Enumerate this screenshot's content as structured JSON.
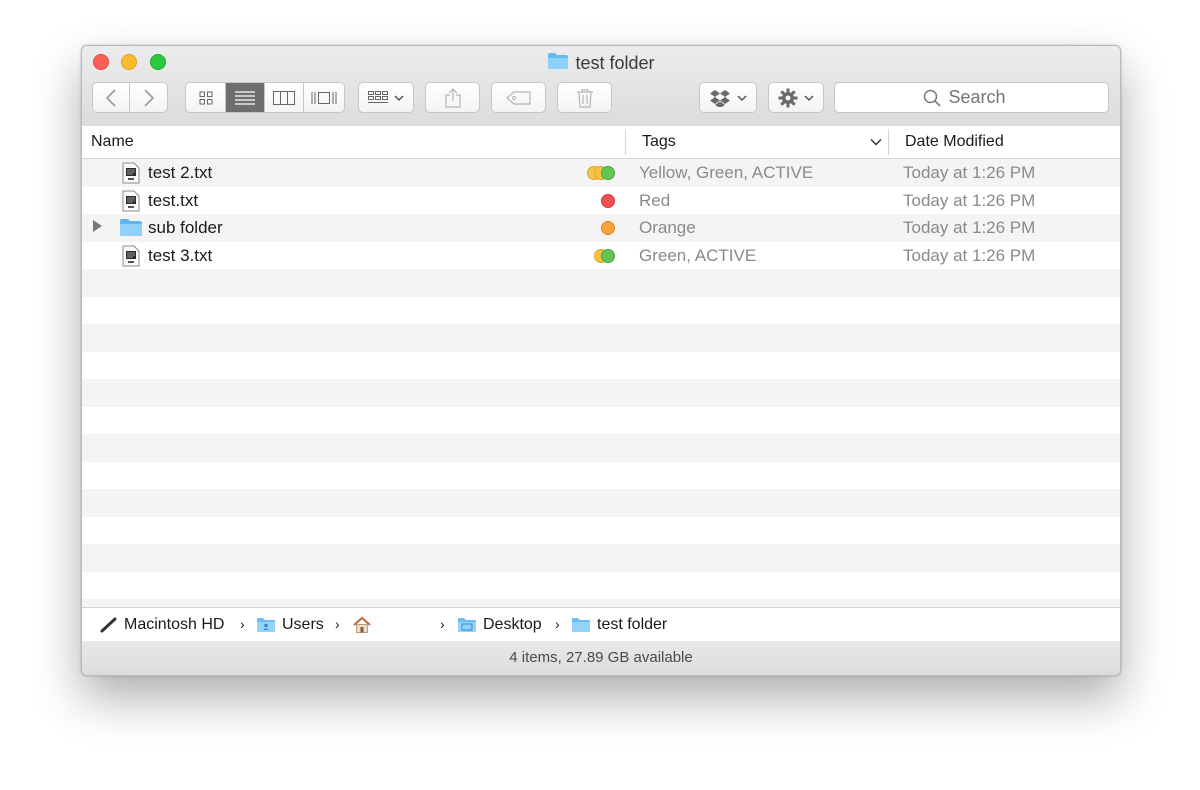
{
  "window": {
    "title": "test folder"
  },
  "toolbar": {
    "search_placeholder": "Search"
  },
  "columns": {
    "name": "Name",
    "tags": "Tags",
    "date": "Date Modified"
  },
  "files": [
    {
      "name": "test 2.txt",
      "kind": "text-file-icon",
      "tags": "Yellow, Green, ACTIVE",
      "date": "Today at 1:26 PM",
      "tag_colors": [
        "#f6c244",
        "#f6c244",
        "#62c554"
      ]
    },
    {
      "name": "test.txt",
      "kind": "text-file-icon",
      "tags": "Red",
      "date": "Today at 1:26 PM",
      "tag_colors": [
        "#f05050"
      ]
    },
    {
      "name": "sub folder",
      "kind": "folder-icon",
      "tags": "Orange",
      "date": "Today at 1:26 PM",
      "tag_colors": [
        "#f7a23b"
      ]
    },
    {
      "name": "test 3.txt",
      "kind": "text-file-icon",
      "tags": "Green, ACTIVE",
      "date": "Today at 1:26 PM",
      "tag_colors": [
        "#f6c244",
        "#62c554"
      ]
    }
  ],
  "path": {
    "disk": "Macintosh HD",
    "users": "Users",
    "desktop": "Desktop",
    "folder": "test folder"
  },
  "status": {
    "text": "4 items, 27.89 GB available"
  }
}
